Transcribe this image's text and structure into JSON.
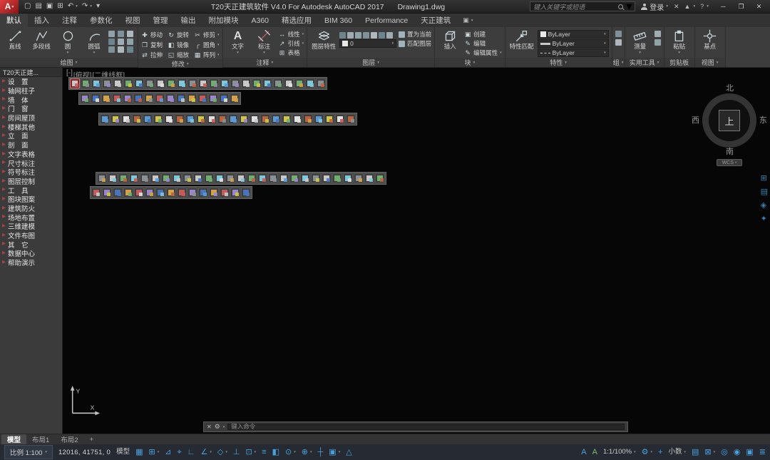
{
  "glyphs": {
    "caret": "▾",
    "item_arrow": "▶",
    "close": "✕",
    "gear": "⚙",
    "panel_toggle": "▣"
  },
  "title_bar": {
    "app_button_label": "A",
    "qat_icons": [
      {
        "name": "new-drawing-icon",
        "glyph": "▢"
      },
      {
        "name": "open-icon",
        "glyph": "▤"
      },
      {
        "name": "save-icon",
        "glyph": "▣"
      },
      {
        "name": "plot-icon",
        "glyph": "⊞"
      },
      {
        "name": "undo-icon",
        "glyph": "↶",
        "caret": true
      },
      {
        "name": "redo-icon",
        "glyph": "↷",
        "caret": true
      },
      {
        "name": "qat-customize-icon",
        "glyph": "▾"
      }
    ],
    "title": "T20天正建筑软件 V4.0 For Autodesk AutoCAD 2017",
    "doc_name": "Drawing1.dwg",
    "search_placeholder": "键入关键字或短语",
    "signin_label": "登录",
    "tool_icons": [
      {
        "name": "exchange-apps-icon",
        "glyph": "✕"
      },
      {
        "name": "stay-connected-icon",
        "glyph": "▲",
        "caret": true
      },
      {
        "name": "help-icon",
        "glyph": "?",
        "caret": true
      }
    ],
    "window_minimize": "─",
    "window_restore": "❐",
    "window_close": "✕"
  },
  "ribbon": {
    "tabs": [
      {
        "label": "默认",
        "active": true
      },
      {
        "label": "插入"
      },
      {
        "label": "注释"
      },
      {
        "label": "参数化"
      },
      {
        "label": "视图"
      },
      {
        "label": "管理"
      },
      {
        "label": "输出"
      },
      {
        "label": "附加模块"
      },
      {
        "label": "A360"
      },
      {
        "label": "精选应用"
      },
      {
        "label": "BIM 360"
      },
      {
        "label": "Performance"
      },
      {
        "label": "天正建筑"
      }
    ],
    "mini_palette": [
      "#9fb3ba",
      "#8aa0a8",
      "#c2ccd1",
      "#76909a",
      "#b0bec5"
    ],
    "panels": {
      "draw": {
        "label": "绘图",
        "big": [
          {
            "label": "直线"
          },
          {
            "label": "多段线"
          },
          {
            "label": "圆",
            "caret": true
          },
          {
            "label": "圆弧",
            "caret": true
          }
        ],
        "mini_count": 9
      },
      "modify": {
        "label": "修改",
        "items": [
          {
            "label": "移动",
            "glyph": "✚"
          },
          {
            "label": "旋转",
            "glyph": "↻"
          },
          {
            "label": "修剪",
            "glyph": "✂",
            "caret": true
          },
          {
            "label": "复制",
            "glyph": "❐"
          },
          {
            "label": "镜像",
            "glyph": "◧"
          },
          {
            "label": "圆角",
            "glyph": "╭",
            "caret": true
          },
          {
            "label": "拉伸",
            "glyph": "⇄"
          },
          {
            "label": "缩放",
            "glyph": "◱"
          },
          {
            "label": "阵列",
            "glyph": "▦",
            "caret": true
          }
        ]
      },
      "annotation": {
        "label": "注释",
        "text_big": {
          "label": "文字",
          "glyph": "A",
          "caret": true
        },
        "dim_big": {
          "label": "标注",
          "caret": true
        },
        "items": [
          {
            "label": "线性",
            "glyph": "↔",
            "caret": true
          },
          {
            "label": "引线",
            "glyph": "↗",
            "caret": true
          },
          {
            "label": "表格",
            "glyph": "⊞"
          }
        ]
      },
      "layers": {
        "label": "图层",
        "big_label": "图层特性",
        "mini_count": 7,
        "combo_value": "0",
        "buttons": [
          {
            "label": "置为当前"
          },
          {
            "label": "匹配图层"
          }
        ]
      },
      "block": {
        "label": "块",
        "big_label": "插入",
        "items": [
          {
            "label": "创建",
            "glyph": "▣"
          },
          {
            "label": "编辑",
            "glyph": "✎"
          },
          {
            "label": "编辑属性",
            "glyph": "✎",
            "caret": true
          }
        ]
      },
      "properties": {
        "label": "特性",
        "big_label": "特性匹配",
        "combos": [
          {
            "kind": "color",
            "value": "ByLayer"
          },
          {
            "kind": "lineweight",
            "value": "ByLayer"
          },
          {
            "kind": "linetype",
            "value": "ByLayer"
          }
        ]
      },
      "groups": {
        "label": "组",
        "mini_count": 2
      },
      "utilities": {
        "label": "实用工具",
        "big_label": "测量",
        "mini_count": 2
      },
      "clipboard": {
        "label": "剪贴板",
        "big_label": "粘贴"
      },
      "view": {
        "label": "视图",
        "big_label": "基点"
      }
    }
  },
  "sidebar": {
    "title": "T20天正建...",
    "items": [
      "设　置",
      "轴网柱子",
      "墙　体",
      "门　窗",
      "房间屋顶",
      "楼梯其他",
      "立　面",
      "剖　面",
      "文字表格",
      "尺寸标注",
      "符号标注",
      "图层控制",
      "工　具",
      "图块图案",
      "建筑防火",
      "场地布置",
      "三维建模",
      "文件布图",
      "其　它",
      "数据中心",
      "帮助演示"
    ]
  },
  "canvas": {
    "viewport_controls": [
      "[-]",
      "[俯视]",
      "[二维线框]"
    ],
    "icon_palette": [
      "#c8c8c8",
      "#d2a24a",
      "#5b9bd5",
      "#6fae6f",
      "#c25b5b",
      "#cfc54a",
      "#7fc7d9",
      "#9a86c9",
      "#e0e0e0",
      "#8a9094",
      "#4a74b8",
      "#b8653f"
    ],
    "toolbars": [
      {
        "count": 24
      },
      {
        "count": 15
      },
      {
        "count": 24
      },
      {
        "count": 27
      },
      {
        "count": 15
      }
    ],
    "compass": {
      "north": "北",
      "south": "南",
      "east": "东",
      "west": "西",
      "center": "上",
      "wcs_label": "WCS"
    },
    "right_edge_icons": [
      {
        "name": "palette-toggle-icon",
        "glyph": "⊞"
      },
      {
        "name": "palette-pages-icon",
        "glyph": "▤"
      },
      {
        "name": "palette-tools-icon",
        "glyph": "◈"
      },
      {
        "name": "palette-pin-icon",
        "glyph": "✦"
      }
    ],
    "ucs": {
      "x_label": "X",
      "y_label": "Y"
    },
    "command_line": {
      "prompt": "键入命令"
    }
  },
  "layout_tabs": {
    "active_index": 0,
    "items": [
      "模型",
      "布局1",
      "布局2",
      "+"
    ]
  },
  "status_bar": {
    "scale_label": "比例 1:100",
    "coordinates": "12016, 41751, 0",
    "left_icons": [
      {
        "name": "model-space-toggle",
        "text": "模型"
      },
      {
        "name": "grid-display-icon",
        "glyph": "▦"
      },
      {
        "name": "snap-mode-icon",
        "glyph": "⊞",
        "caret": true
      },
      {
        "name": "infer-constraints-icon",
        "glyph": "⊿"
      },
      {
        "name": "dynamic-input-icon",
        "glyph": "⌖"
      },
      {
        "name": "ortho-mode-icon",
        "glyph": "∟"
      },
      {
        "name": "polar-tracking-icon",
        "glyph": "∠",
        "caret": true
      },
      {
        "name": "isometric-drafting-icon",
        "glyph": "◇",
        "caret": true
      },
      {
        "name": "object-snap-tracking-icon",
        "glyph": "⊥"
      },
      {
        "name": "object-snap-icon",
        "glyph": "⊡",
        "caret": true
      },
      {
        "name": "lineweight-display-icon",
        "glyph": "≡"
      },
      {
        "name": "transparency-icon",
        "glyph": "◧"
      },
      {
        "name": "selection-cycling-icon",
        "glyph": "⊙",
        "caret": true
      },
      {
        "name": "3d-object-snap-icon",
        "glyph": "⊕",
        "caret": true
      },
      {
        "name": "dynamic-ucs-icon",
        "glyph": "┼"
      },
      {
        "name": "selection-filtering-icon",
        "glyph": "▣",
        "caret": true
      },
      {
        "name": "gizmo-icon",
        "glyph": "△"
      }
    ],
    "right_icons": [
      {
        "name": "annotation-visibility-icon",
        "glyph": "A"
      },
      {
        "name": "autoscale-icon",
        "glyph": "A",
        "color": "#7db96f"
      },
      {
        "name": "annotation-scale-control",
        "text": "1:1/100%",
        "caret": true
      },
      {
        "name": "workspace-switching-icon",
        "glyph": "⚙",
        "caret": true
      },
      {
        "name": "annotation-monitor-icon",
        "glyph": "+"
      },
      {
        "name": "units-control",
        "text": "小数",
        "caret": true
      },
      {
        "name": "quick-properties-icon",
        "glyph": "▤"
      },
      {
        "name": "lock-ui-icon",
        "glyph": "⊠",
        "caret": true
      },
      {
        "name": "isolate-objects-icon",
        "glyph": "◎"
      },
      {
        "name": "graphics-performance-icon",
        "glyph": "◉"
      },
      {
        "name": "clean-screen-icon",
        "glyph": "▣"
      },
      {
        "name": "customization-icon",
        "glyph": "≣"
      }
    ]
  }
}
